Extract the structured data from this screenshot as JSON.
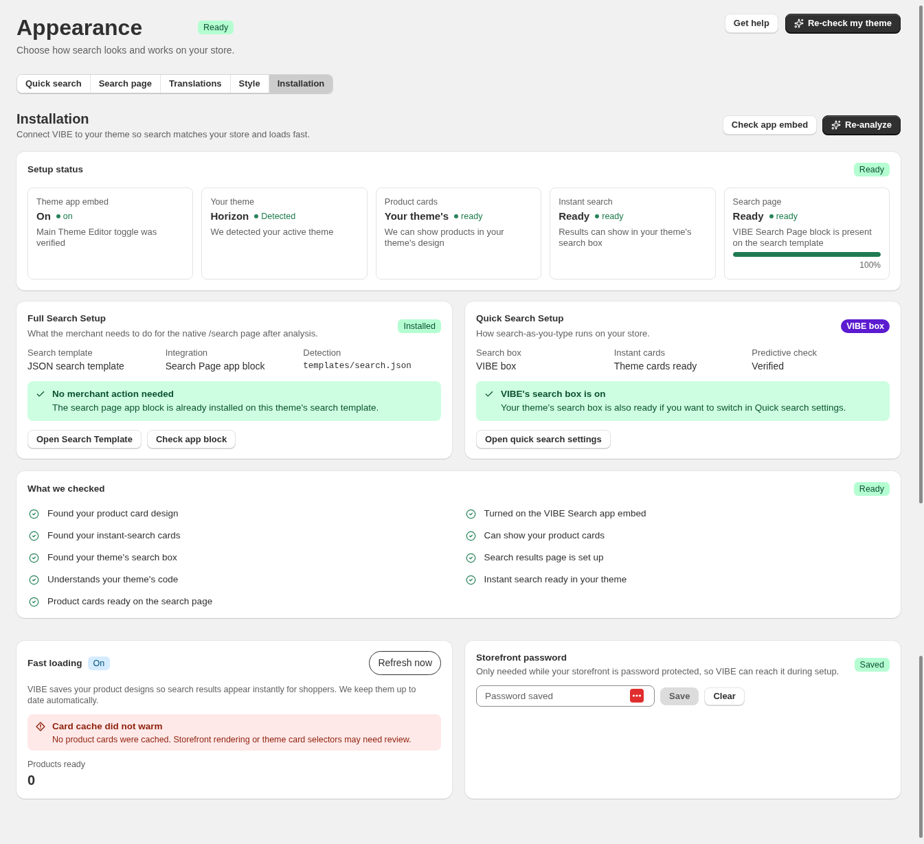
{
  "header": {
    "title": "Appearance",
    "badge": {
      "label": "Ready",
      "kind": "success"
    },
    "subtitle": "Choose how search looks and works on your store.",
    "actions": [
      {
        "label": "Get help",
        "kind": "secondary"
      },
      {
        "label": "Re-check my theme",
        "kind": "primary"
      }
    ]
  },
  "tabs": [
    {
      "label": "Quick search",
      "selected": false
    },
    {
      "label": "Search page",
      "selected": false
    },
    {
      "label": "Translations",
      "selected": false
    },
    {
      "label": "Style",
      "selected": false
    },
    {
      "label": "Installation",
      "selected": true
    }
  ],
  "installation": {
    "title": "Installation",
    "subtitle": "Connect VIBE to your theme so search matches your store and loads fast.",
    "actions": [
      {
        "label": "Check app embed",
        "kind": "secondary"
      },
      {
        "label": "Re-analyze",
        "kind": "primary"
      }
    ]
  },
  "setup_status": {
    "title": "Setup status",
    "badge": {
      "label": "Ready",
      "kind": "success"
    },
    "items": [
      {
        "label": "Theme app embed",
        "value": "On",
        "status": "on",
        "description": "Main Theme Editor toggle was verified"
      },
      {
        "label": "Your theme",
        "value": "Horizon",
        "status": "Detected",
        "description": "We detected your active theme"
      },
      {
        "label": "Product cards",
        "value": "Your theme's",
        "status": "ready",
        "description": "We can show products in your theme's design"
      },
      {
        "label": "Instant search",
        "value": "Ready",
        "status": "ready",
        "description": "Results can show in your theme's search box"
      },
      {
        "label": "Search page",
        "value": "Ready",
        "status": "ready",
        "description": "VIBE Search Page block is present on the search template",
        "level": 1,
        "reading": "100%"
      }
    ]
  },
  "full_search_setup": {
    "title": "Full Search Setup",
    "subtitle": "What the merchant needs to do for the native /search page after analysis.",
    "badge": {
      "label": "Installed",
      "kind": "success"
    },
    "fields": [
      {
        "label": "Search template",
        "value": "JSON search template",
        "kind": "text"
      },
      {
        "label": "Integration",
        "value": "Search Page app block",
        "kind": "text"
      },
      {
        "label": "Detection",
        "value": "templates/search.json",
        "kind": "code"
      }
    ],
    "notice": {
      "title": "No merchant action needed",
      "text": "The search page app block is already installed on this theme's search template."
    },
    "buttons": [
      "Open Search Template",
      "Check app block"
    ]
  },
  "quick_search_setup": {
    "title": "Quick Search Setup",
    "subtitle": "How search-as-you-type runs on your store.",
    "badge": {
      "label": "VIBE box",
      "kind": "brand"
    },
    "fields": [
      {
        "label": "Search box",
        "value": "VIBE box",
        "kind": "text"
      },
      {
        "label": "Instant cards",
        "value": "Theme cards ready",
        "kind": "text"
      },
      {
        "label": "Predictive check",
        "value": "Verified",
        "kind": "text"
      }
    ],
    "notice": {
      "title": "VIBE's search box is on",
      "text": "Your theme's search box is also ready if you want to switch in Quick search settings."
    },
    "buttons": [
      "Open quick search settings"
    ]
  },
  "what_we_checked": {
    "title": "What we checked",
    "badge": {
      "label": "Ready",
      "kind": "success"
    },
    "columns": [
      [
        "Found your product card design",
        "Found your instant-search cards",
        "Found your theme's search box",
        "Understands your theme's code",
        "Product cards ready on the search page"
      ],
      [
        "Turned on the VIBE Search app embed",
        "Can show your product cards",
        "Search results page is set up",
        "Instant search ready in your theme"
      ]
    ]
  },
  "fast_loading": {
    "title": "Fast loading",
    "badge": {
      "label": "On",
      "kind": "info"
    },
    "action": "Refresh now",
    "description": "VIBE saves your product designs so search results appear instantly for shoppers. We keep them up to date automatically.",
    "alert": {
      "title": "Card cache did not warm",
      "text": "No product cards were cached. Storefront rendering or theme card selectors may need review."
    },
    "stat": {
      "label": "Products ready",
      "value": "0"
    }
  },
  "storefront_password": {
    "title": "Storefront password",
    "subtitle": "Only needed while your storefront is password protected, so VIBE can reach it during setup.",
    "badge": {
      "label": "Saved",
      "kind": "success"
    },
    "field": {
      "placeholder": "Password saved"
    },
    "buttons": [
      {
        "label": "Save",
        "disabled": true
      },
      {
        "label": "Clear",
        "disabled": false
      }
    ]
  }
}
